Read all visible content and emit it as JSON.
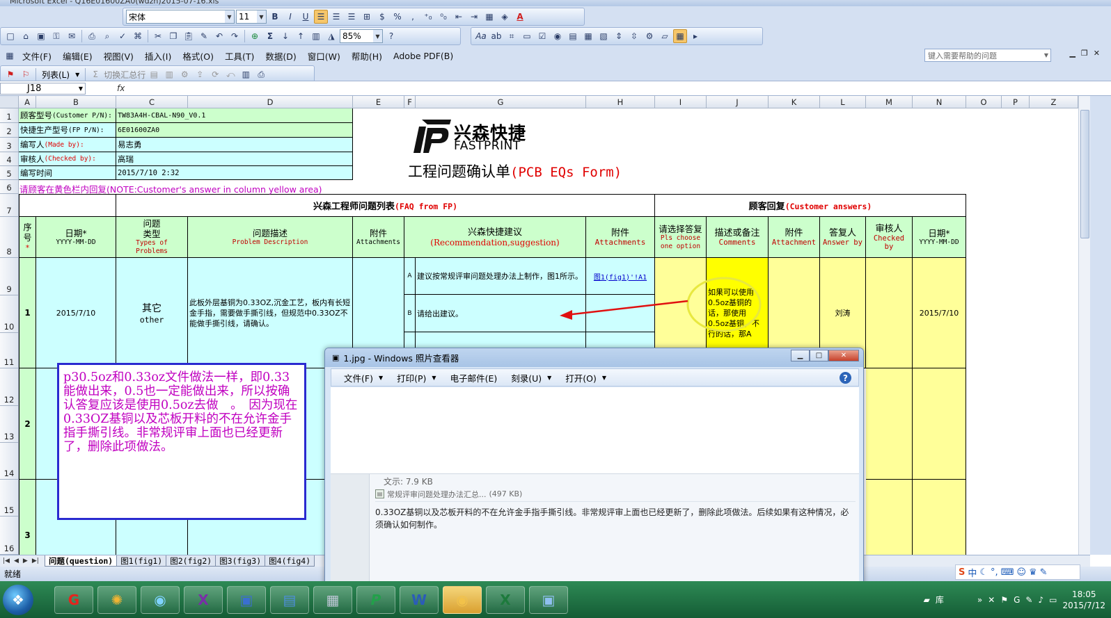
{
  "window": {
    "title": "Microsoft Excel - Q16E01600ZA0(wdzh)2015-07-16.xls"
  },
  "toolbar": {
    "font_name": "宋体",
    "font_size": "11",
    "zoom": "85%",
    "percent": "%",
    "comma": ","
  },
  "menu": {
    "items": [
      "文件(F)",
      "编辑(E)",
      "视图(V)",
      "插入(I)",
      "格式(O)",
      "工具(T)",
      "数据(D)",
      "窗口(W)",
      "帮助(H)",
      "Adobe PDF(B)"
    ],
    "help_placeholder": "键入需要帮助的问题",
    "list_label": "列表(L)",
    "toggle_total": "切换汇总行"
  },
  "formula": {
    "cell_ref": "J18",
    "fx": "fx"
  },
  "grid": {
    "columns": [
      "A",
      "B",
      "C",
      "D",
      "E",
      "F",
      "G",
      "H",
      "I",
      "J",
      "K",
      "L",
      "M",
      "N",
      "O",
      "P",
      "Z"
    ],
    "rows": [
      "1",
      "2",
      "3",
      "4",
      "5",
      "6",
      "7",
      "8",
      "9",
      "10",
      "11",
      "12",
      "13",
      "14",
      "15",
      "16"
    ]
  },
  "sheet": {
    "info": [
      {
        "label_cn": "顾客型号",
        "label_en": "(Customer P/N):",
        "value": "TW83A4H-CBAL-N90_V0.1"
      },
      {
        "label_cn": "快捷生产型号",
        "label_en": "(FP P/N):",
        "value": "6E01600ZA0"
      },
      {
        "label_cn": "编写人",
        "label_en": "(Made by):",
        "value": "易志勇"
      },
      {
        "label_cn": "审核人",
        "label_en": "(Checked by):",
        "value": "高瑞"
      },
      {
        "label_cn": "编写时间",
        "label_en": "",
        "value": "2015/7/10 2:32"
      }
    ],
    "brand_cn": "兴森快捷",
    "brand_en": "FASTPRINT",
    "form_title_cn": "工程问题确认单",
    "form_title_en": "(PCB EQs Form)",
    "note": "请顾客在黄色栏内回复(NOTE:Customer's answer in column yellow area)",
    "section_fp_cn": "兴森工程师问题列表",
    "section_fp_en": "(FAQ from FP)",
    "section_cust_cn": "顾客回复",
    "section_cust_en": "(Customer answers)",
    "headers": {
      "seq": "序号",
      "star": "*",
      "date_cn": "日期*",
      "date_en": "YYYY-MM-DD",
      "type_cn": "问题类型",
      "type_en": "Types of Problems",
      "desc_cn": "问题描述",
      "desc_en": "Problem Description",
      "attach_cn": "附件",
      "attach_en": "Attachments",
      "rec_cn": "兴森快捷建议",
      "rec_en": "(Recommendation,suggestion)",
      "attach2_cn": "附件",
      "attach2_en": "Attachments",
      "choose_cn": "请选择答复",
      "choose_en": "Pls choose one option",
      "comments_cn": "描述或备注",
      "comments_en": "Comments",
      "attach3_cn": "附件",
      "attach3_en": "Attachment",
      "answer_cn": "答复人",
      "answer_en": "Answer by",
      "checked_cn": "审核人",
      "checked_en": "Checked by",
      "date2_cn": "日期*",
      "date2_en": "YYYY-MM-DD"
    },
    "row1": {
      "seq": "1",
      "date": "2015/7/10",
      "type_cn": "其它",
      "type_en": "other",
      "desc": "此板外层基铜为0.33OZ,沉金工艺，板内有长短金手指，需要做手撕引线，但规范中0.33OZ不能做手撕引线，请确认。",
      "option_a_label": "A",
      "option_a": "建议按常规评审问题处理办法上制作，图1所示。",
      "option_b_label": "B",
      "option_b": "请给出建议。",
      "attach_link": "图1(fig1)'!A1",
      "comment": "如果可以使用0.5oz基铜的话，那使用0.5oz基铜，不行的话，那A",
      "answer_by": "刘涛",
      "date2": "2015/7/10"
    },
    "row2": {
      "seq": "2"
    },
    "row3": {
      "seq": "3"
    }
  },
  "callout": {
    "text": "p30.5oz和0.33oz文件做法一样，即0.33能做出来，0.5也一定能做出来，所以按确认答复应该是使用0.5oz去做　。　因为现在0.33OZ基铜以及芯板开料的不在允许金手指手撕引线。非常规评审上面也已经更新了，删除此项做法。"
  },
  "tabs": [
    "问题(question)",
    "图1(fig1)",
    "图2(fig2)",
    "图3(fig3)",
    "图4(fig4)"
  ],
  "status": {
    "ready": "就绪"
  },
  "viewer": {
    "title": "1.jpg - Windows 照片查看器",
    "menu": [
      "文件(F)",
      "打印(P)",
      "电子邮件(E)",
      "刻录(U)",
      "打开(O)"
    ],
    "img_top": "文示: 7.9 KB",
    "attachment": "常规评审问题处理办法汇总...",
    "attachment_size": "(497 KB)",
    "body": "0.33OZ基铜以及芯板开料的不在允许金手指手撕引线。非常规评审上面也已经更新了，删除此项做法。后续如果有这种情况，必须确认如何制作。"
  },
  "ime": {
    "label": "中"
  },
  "taskbar": {
    "tray_label": "库",
    "time": "18:05",
    "date": "2015/7/12"
  }
}
